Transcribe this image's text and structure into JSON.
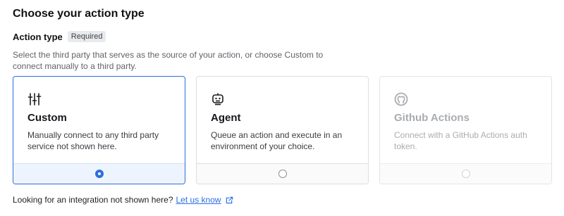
{
  "page": {
    "title": "Choose your action type"
  },
  "field": {
    "label": "Action type",
    "badge": "Required",
    "description": "Select the third party that serves as the source of your action, or choose Custom to connect manually to a third party."
  },
  "cards": [
    {
      "title": "Custom",
      "body": "Manually connect to any third party service not shown here.",
      "icon": "sliders-icon",
      "state": "selected"
    },
    {
      "title": "Agent",
      "body": "Queue an action and execute in an environment of your choice.",
      "icon": "robot-icon",
      "state": "default"
    },
    {
      "title": "Github Actions",
      "body": "Connect with a GitHub Actions auth token.",
      "icon": "github-icon",
      "state": "disabled"
    }
  ],
  "footer": {
    "text": "Looking for an integration not shown here?",
    "link": "Let us know"
  },
  "colors": {
    "accent": "#2d6ee0",
    "text": "#111111",
    "muted": "#5f6368",
    "disabled": "#a9acb1"
  }
}
